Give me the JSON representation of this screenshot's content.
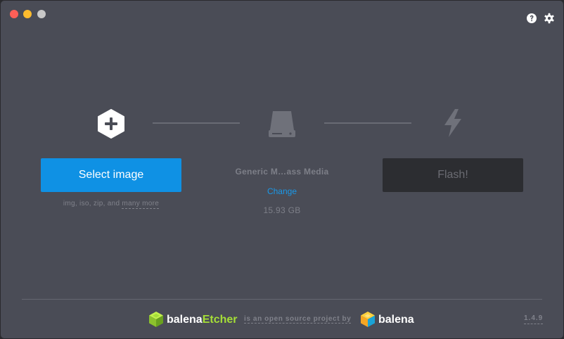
{
  "window": {
    "traffic_lights": {
      "close_color": "#fe5f57",
      "minimize_color": "#febc2e",
      "maximize_color": "#c8c8c8"
    },
    "toolbar_icons": [
      "help-icon",
      "settings-icon"
    ]
  },
  "steps": {
    "image": {
      "icon": "plus-hexagon-icon",
      "button_label": "Select image",
      "extensions_text": "img, iso, zip, and",
      "many_more_label": "many more"
    },
    "drive": {
      "icon": "drive-icon",
      "name": "Generic M…ass Media",
      "change_label": "Change",
      "size": "15.93 GB"
    },
    "flash": {
      "icon": "lightning-icon",
      "button_label": "Flash!"
    }
  },
  "footer": {
    "etcher_brand_prefix": "balena",
    "etcher_brand_suffix": "Etcher",
    "tagline": "is an open source project by",
    "balena_brand": "balena",
    "version": "1.4.9"
  },
  "colors": {
    "background": "#4a4c56",
    "primary_button": "#0f91e4",
    "disabled_button": "#2c2d31",
    "link": "#1a98e8",
    "etcher_accent": "#a5de37"
  }
}
